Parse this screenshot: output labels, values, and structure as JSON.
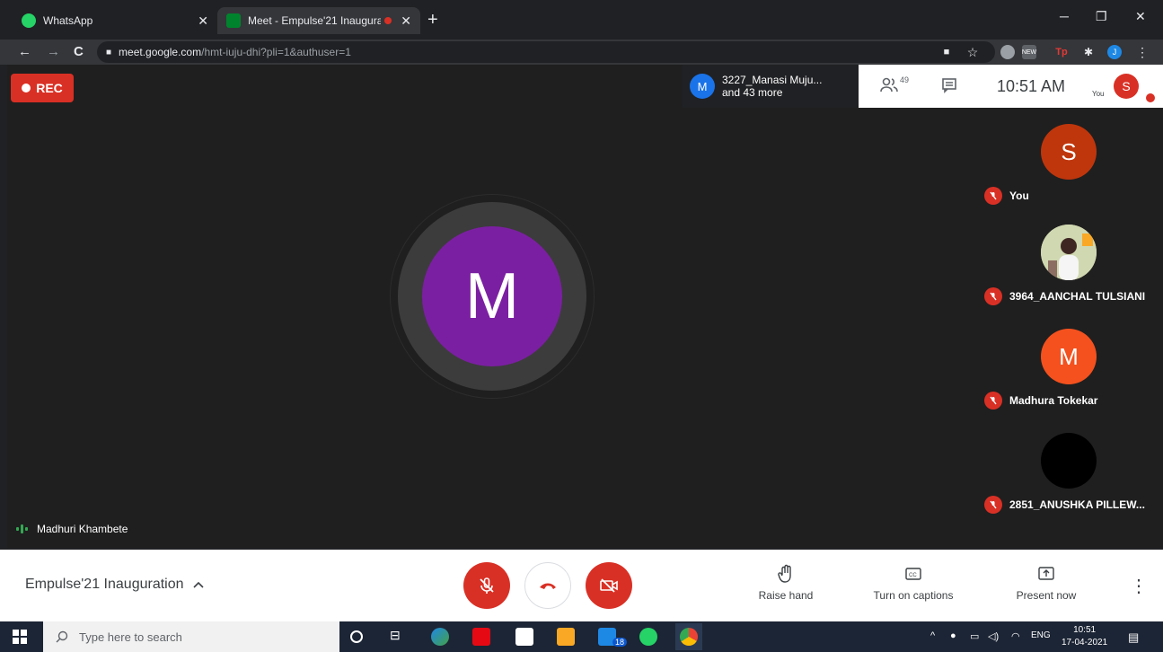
{
  "browser": {
    "tabs": [
      {
        "title": "WhatsApp",
        "close": "✕"
      },
      {
        "title": "Meet - Empulse'21 Inaugura",
        "close": "✕"
      }
    ],
    "new_tab": "+",
    "window_controls": {
      "minimize": "─",
      "maximize": "❐",
      "close": "✕"
    },
    "nav": {
      "back": "←",
      "forward": "→",
      "reload": "C"
    },
    "url_host": "meet.google.com",
    "url_path": "/hmt-iuju-dhi?pli=1&authuser=1",
    "profile_initial": "J"
  },
  "meet": {
    "rec_label": "REC",
    "main_initial": "M",
    "active_speaker": "Madhuri Khambete",
    "presenter": {
      "initial": "M",
      "line1": "3227_Manasi Muju...",
      "line2": "and 43 more"
    },
    "participant_count": "49",
    "time": "10:51 AM",
    "you_label": "You",
    "self_initial": "S",
    "participants": [
      {
        "initial": "S",
        "name": "You"
      },
      {
        "initial": "",
        "name": "3964_AANCHAL TULSIANI"
      },
      {
        "initial": "M",
        "name": "Madhura Tokekar"
      },
      {
        "initial": "",
        "name": "2851_ANUSHKA PILLEW..."
      }
    ],
    "meeting_title": "Empulse'21 Inauguration",
    "actions": {
      "raise_hand": "Raise hand",
      "captions": "Turn on captions",
      "present": "Present now"
    },
    "colors": {
      "accent_red": "#d93025",
      "main_avatar": "#7b1fa2",
      "orange_avatar": "#f4511e"
    }
  },
  "taskbar": {
    "search_placeholder": "Type here to search",
    "mail_badge": "18",
    "lang": "ENG",
    "time": "10:51",
    "date": "17-04-2021"
  }
}
